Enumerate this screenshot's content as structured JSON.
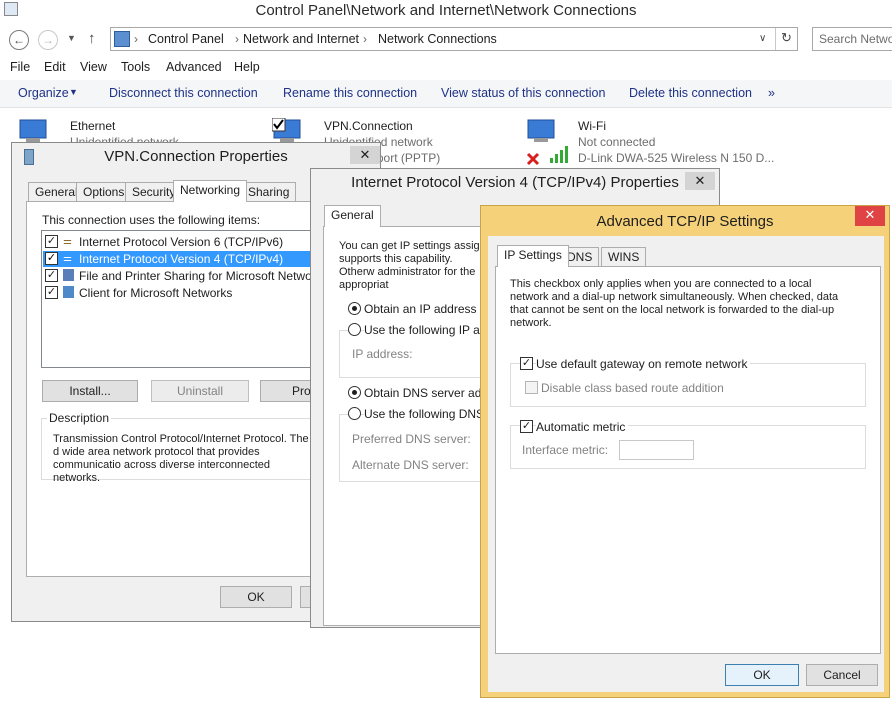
{
  "window": {
    "title": "Control Panel\\Network and Internet\\Network Connections",
    "breadcrumb": [
      "Control Panel",
      "Network and Internet",
      "Network Connections"
    ],
    "search_placeholder": "Search Netwo"
  },
  "menu": [
    "File",
    "Edit",
    "View",
    "Tools",
    "Advanced",
    "Help"
  ],
  "commands": [
    "Organize",
    "Disconnect this connection",
    "Rename this connection",
    "View status of this connection",
    "Delete this connection",
    "»"
  ],
  "connections": [
    {
      "name": "Ethernet",
      "status": "Unidentified network",
      "device": ""
    },
    {
      "name": "VPN.Connection",
      "status": "Unidentified network",
      "device": "WAN Miniport (PPTP)"
    },
    {
      "name": "Wi-Fi",
      "status": "Not connected",
      "device": "D-Link DWA-525 Wireless N 150 D..."
    }
  ],
  "vpn_dialog": {
    "title": "VPN.Connection Properties",
    "tabs": [
      "General",
      "Options",
      "Security",
      "Networking",
      "Sharing"
    ],
    "uses_label": "This connection uses the following items:",
    "items": [
      {
        "label": "Internet Protocol Version 6 (TCP/IPv6)",
        "checked": true
      },
      {
        "label": "Internet Protocol Version 4 (TCP/IPv4)",
        "checked": true
      },
      {
        "label": "File and Printer Sharing for Microsoft Networks",
        "checked": true
      },
      {
        "label": "Client for Microsoft Networks",
        "checked": true
      }
    ],
    "install": "Install...",
    "uninstall": "Uninstall",
    "properties": "Prope",
    "description_title": "Description",
    "description": "Transmission Control Protocol/Internet Protocol. The d wide area network protocol that provides communicatio across diverse interconnected networks.",
    "ok": "OK"
  },
  "ipv4_dialog": {
    "title": "Internet Protocol Version 4 (TCP/IPv4) Properties",
    "tab": "General",
    "intro": "You can get IP settings assign supports this capability. Otherw administrator for the appropriat",
    "obtain_ip": "Obtain an IP address aut",
    "use_ip": "Use the following IP addr",
    "ip_label": "IP address:",
    "obtain_dns": "Obtain DNS server addre",
    "use_dns": "Use the following DNS se",
    "pref_dns": "Preferred DNS server:",
    "alt_dns": "Alternate DNS server:"
  },
  "adv_dialog": {
    "title": "Advanced TCP/IP Settings",
    "tabs": [
      "IP Settings",
      "DNS",
      "WINS"
    ],
    "note": "This checkbox only applies when you are connected to a local network and a dial-up network simultaneously.  When checked, data that cannot be sent on the local network is forwarded to the dial-up network.",
    "default_gw": "Use default gateway on remote network",
    "class_route": "Disable class based route addition",
    "auto_metric": "Automatic metric",
    "if_metric": "Interface metric:",
    "ok": "OK",
    "cancel": "Cancel"
  },
  "colors": {
    "accent": "#3399ff",
    "adv_frame": "#f5d27a",
    "close_red": "#e04343"
  }
}
